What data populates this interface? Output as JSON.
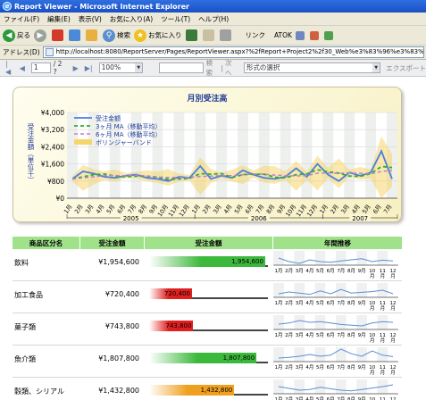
{
  "window": {
    "title": "Report Viewer - Microsoft Internet Explorer"
  },
  "menu": [
    "ファイル(F)",
    "編集(E)",
    "表示(V)",
    "お気に入り(A)",
    "ツール(T)",
    "ヘルプ(H)"
  ],
  "toolbar": {
    "back": "戻る",
    "search": "検索",
    "favorites": "お気に入り",
    "links": "リンク",
    "atok": "ATOK"
  },
  "address": {
    "label": "アドレス(D)",
    "url": "http://localhost:8080/ReportServer/Pages/ReportViewer.aspx?%2fReport+Project2%2f30_Web%e3%83%96%e3%83%a9%e3%83%a6%e3%82%b6"
  },
  "viewer": {
    "page_current": "1",
    "page_total": "/ 2 ?",
    "zoom": "100%",
    "find_label": "検索",
    "next_label": "次へ",
    "format_select": "形式の選択",
    "export_label": "エクスポート"
  },
  "chart_data": {
    "type": "line",
    "title": "月別受注高",
    "ylabel": "受注金額（単位千）",
    "ylim": [
      0,
      4000
    ],
    "yticks": [
      "¥4,000",
      "¥3,200",
      "¥2,400",
      "¥1,600",
      "¥800",
      "¥0"
    ],
    "categories": [
      "1月",
      "2月",
      "3月",
      "4月",
      "5月",
      "6月",
      "7月",
      "8月",
      "9月",
      "10月",
      "11月",
      "12月",
      "1月",
      "2月",
      "3月",
      "4月",
      "5月",
      "6月",
      "7月",
      "8月",
      "9月",
      "10月",
      "11月",
      "12月",
      "1月",
      "2月",
      "3月",
      "4月",
      "5月",
      "6月",
      "7月"
    ],
    "years": [
      "2005",
      "2006",
      "2007"
    ],
    "legend_position": "top-left",
    "series": [
      {
        "name": "受注金額",
        "color": "#4a7ee0",
        "values": [
          900,
          1250,
          1150,
          1000,
          950,
          1050,
          1100,
          950,
          900,
          800,
          1000,
          950,
          1500,
          900,
          1050,
          950,
          1300,
          1100,
          950,
          900,
          1000,
          1400,
          1000,
          1600,
          1100,
          800,
          1200,
          1050,
          1200,
          2200,
          900
        ]
      },
      {
        "name": "3ヶ月 MA（移動平均）",
        "color": "#2bb02b",
        "values": [
          900,
          1000,
          1100,
          1130,
          1030,
          1000,
          1030,
          1030,
          980,
          880,
          900,
          920,
          1150,
          1120,
          1150,
          970,
          1100,
          1120,
          1120,
          980,
          950,
          1100,
          1130,
          1330,
          1230,
          1170,
          1030,
          1020,
          1150,
          1480,
          1430
        ]
      },
      {
        "name": "6ヶ月 MA（移動平均）",
        "color": "#c080d0",
        "values": [
          900,
          950,
          1000,
          1050,
          1060,
          1050,
          1080,
          1040,
          990,
          970,
          960,
          960,
          1020,
          1030,
          1060,
          1050,
          1100,
          1130,
          1120,
          1080,
          1050,
          1040,
          1050,
          1170,
          1180,
          1160,
          1180,
          1160,
          1140,
          1250,
          1300
        ]
      },
      {
        "name": "ボリンジャーバンド",
        "color": "#f5d66b",
        "values": []
      }
    ]
  },
  "table": {
    "headers": [
      "商品区分名",
      "受注金額",
      "受注金額",
      "年間推移"
    ],
    "max_value": 2000000,
    "spark_labels": [
      "1月",
      "2月",
      "3月",
      "4月",
      "5月",
      "6月",
      "7月",
      "8月",
      "9月",
      "10月",
      "11月",
      "12月"
    ],
    "rows": [
      {
        "name": "飲料",
        "amount": "¥1,954,600",
        "bar_label": "1,954,600",
        "value": 1954600,
        "bar_color": "#3cb83c",
        "spark": [
          60,
          50,
          45,
          55,
          50,
          48,
          52,
          55,
          58,
          50,
          54,
          52
        ]
      },
      {
        "name": "加工食品",
        "amount": "¥720,400",
        "bar_label": "720,400",
        "value": 720400,
        "bar_color": "#e02020",
        "spark": [
          50,
          55,
          52,
          48,
          58,
          50,
          62,
          52,
          54,
          56,
          60,
          50
        ]
      },
      {
        "name": "菓子類",
        "amount": "¥743,800",
        "bar_label": "743,800",
        "value": 743800,
        "bar_color": "#e02020",
        "spark": [
          55,
          58,
          65,
          60,
          62,
          58,
          54,
          52,
          50,
          58,
          62,
          60
        ]
      },
      {
        "name": "魚介類",
        "amount": "¥1,807,800",
        "bar_label": "1,807,800",
        "value": 1807800,
        "bar_color": "#3cb83c",
        "spark": [
          50,
          52,
          55,
          60,
          55,
          58,
          75,
          62,
          55,
          70,
          58,
          54
        ]
      },
      {
        "name": "穀類、シリアル",
        "amount": "¥1,432,800",
        "bar_label": "1,432,800",
        "value": 1432800,
        "bar_color": "#f0a020",
        "spark": [
          60,
          55,
          50,
          52,
          58,
          54,
          50,
          48,
          52,
          56,
          60,
          65
        ]
      }
    ]
  }
}
